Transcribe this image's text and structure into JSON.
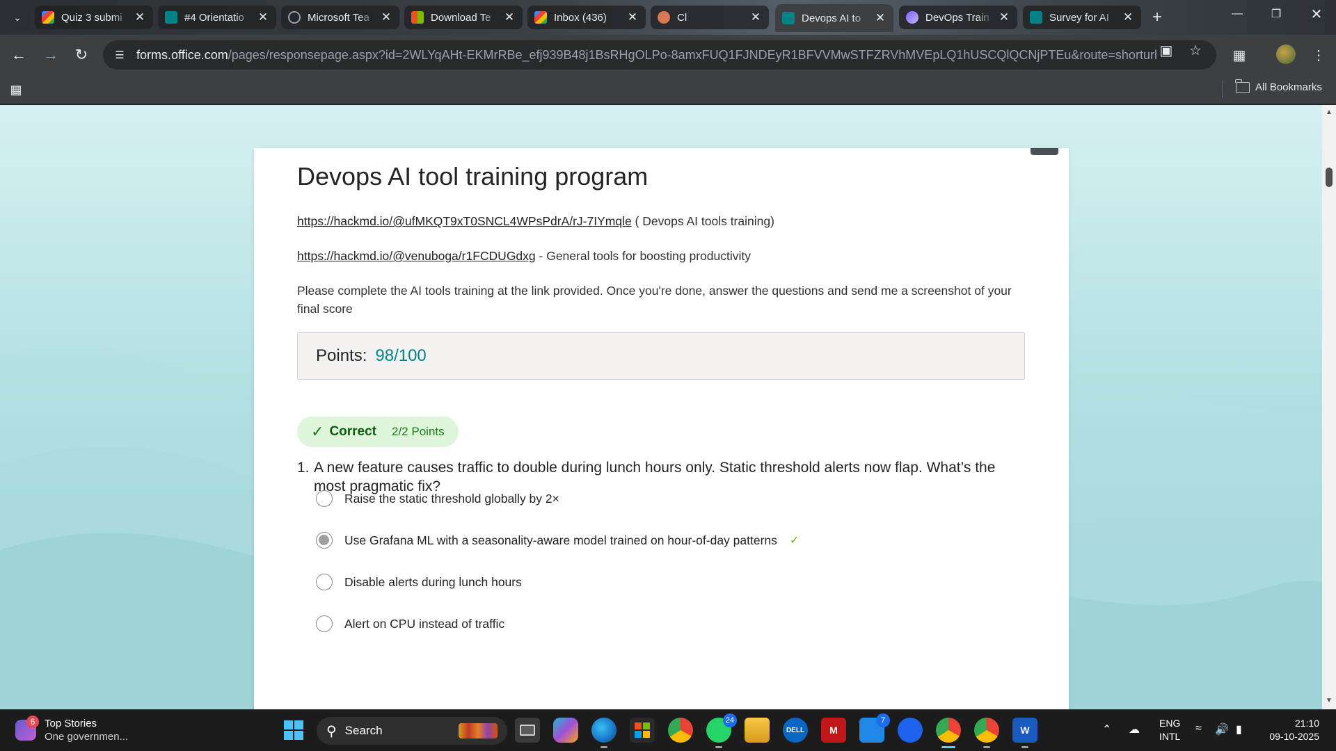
{
  "browser": {
    "tabs": [
      {
        "title": "Quiz 3 submi",
        "favicon": "gmail-icon",
        "color": "#ea4335"
      },
      {
        "title": "#4 Orientatio",
        "favicon": "forms-icon",
        "color": "#038387"
      },
      {
        "title": "Microsoft Tea",
        "favicon": "globe-icon",
        "color": "#9aa0a6"
      },
      {
        "title": "Download Te",
        "favicon": "windows-store-icon",
        "color": "#f25022"
      },
      {
        "title": "Inbox (436)",
        "favicon": "gmail-icon",
        "color": "#ea4335"
      },
      {
        "title": "Cl",
        "favicon": "claude-icon",
        "color": "#d97757"
      },
      {
        "title": "Devops AI to",
        "favicon": "forms-icon",
        "color": "#038387",
        "active": true
      },
      {
        "title": "DevOps Train",
        "favicon": "loop-icon",
        "color": "#7b61ff"
      },
      {
        "title": "Survey for AI",
        "favicon": "forms-icon",
        "color": "#038387"
      }
    ],
    "new_tab_label": "+",
    "url_host": "forms.office.com",
    "url_path": "/pages/responsepage.aspx?id=2WLYqAHt-EKMrRBe_efj939B48j1BsRHgOLPo-8amxFUQ1FJNDEyR1BFVVMwSTFZRVhMVEpLQ1hUSCQlQCNjPTEu&route=shorturl",
    "bookmarks_label": "All Bookmarks"
  },
  "form": {
    "title": "Devops AI tool training program",
    "link1": "https://hackmd.io/@ufMKQT9xT0SNCL4WPsPdrA/rJ-7IYmqle",
    "link1_suffix": " ( Devops AI tools training)",
    "link2": "https://hackmd.io/@venuboga/r1FCDUGdxg",
    "link2_suffix": " - General tools for boosting productivity",
    "instructions": "Please complete the AI tools training at the link provided. Once you're done, answer the questions and send me a screenshot of your final score",
    "points_label": "Points:",
    "points_value": "98/100",
    "question1": {
      "badge_label": "Correct",
      "badge_points": "2/2 Points",
      "number": "1.",
      "text": "A new feature causes traffic to double during lunch hours only. Static threshold alerts now flap. What’s the most pragmatic fix?",
      "options": [
        {
          "label": "Raise the static threshold globally by 2×",
          "selected": false
        },
        {
          "label": "Use Grafana ML with a seasonality-aware model trained on hour-of-day patterns",
          "selected": true,
          "correct": true
        },
        {
          "label": "Disable alerts during lunch hours",
          "selected": false
        },
        {
          "label": "Alert on CPU instead of traffic",
          "selected": false
        }
      ]
    }
  },
  "taskbar": {
    "news_title": "Top Stories",
    "news_subtitle": "One governmen...",
    "news_badge": "6",
    "search_label": "Search",
    "whatsapp_badge": "24",
    "todo_badge": "7",
    "lang_line1": "ENG",
    "lang_line2": "INTL",
    "time": "21:10",
    "date": "09-10-2025"
  }
}
